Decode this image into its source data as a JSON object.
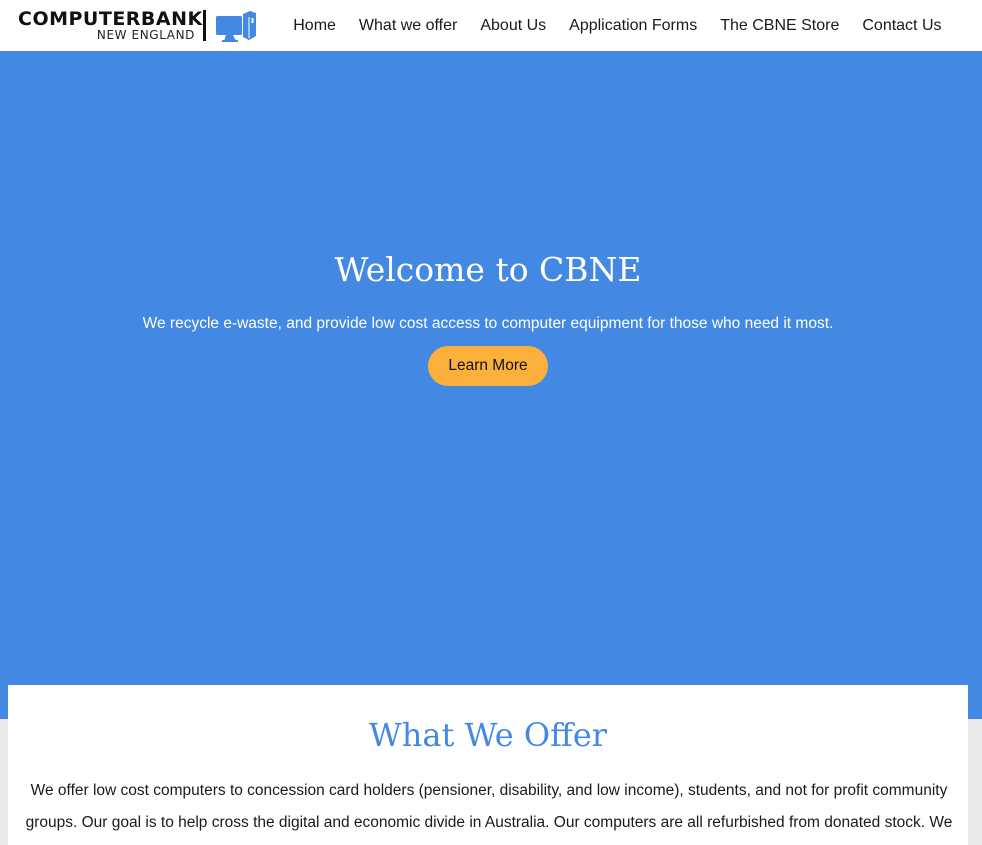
{
  "header": {
    "logo_main": "COMPUTERBANK",
    "logo_sub": "NEW ENGLAND",
    "logo_icon": "computer-monitor-tower-icon",
    "logo_color": "#4389e3"
  },
  "nav": {
    "items": [
      {
        "label": "Home"
      },
      {
        "label": "What we offer"
      },
      {
        "label": "About Us"
      },
      {
        "label": "Application Forms"
      },
      {
        "label": "The CBNE Store"
      },
      {
        "label": "Contact Us"
      }
    ]
  },
  "hero": {
    "title": "Welcome to CBNE",
    "subtitle": "We recycle e-waste, and provide low cost access to computer equipment for those who need it most.",
    "button_label": "Learn More",
    "background_color": "#4389e3",
    "button_color": "#fbb03b"
  },
  "offer": {
    "title": "What We Offer",
    "text": "We offer low cost computers to concession card holders (pensioner, disability, and low income), students, and not for profit community groups. Our goal is to help cross the digital and economic divide in Australia. Our computers are all refurbished from donated stock. We",
    "title_color": "#4389e3"
  }
}
